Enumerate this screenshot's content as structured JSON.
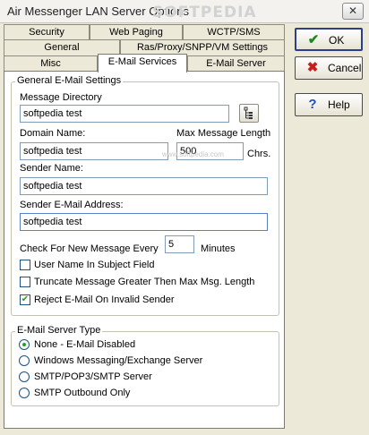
{
  "window": {
    "title": "Air Messenger LAN Server Options",
    "watermark": "SOFTPEDIA",
    "watermark_url": "www.softpedia.com"
  },
  "tabs": {
    "row1": [
      "Security",
      "Web Paging",
      "WCTP/SMS"
    ],
    "row2": [
      "General",
      "Ras/Proxy/SNPP/VM Settings"
    ],
    "row3": [
      "Misc",
      "E-Mail Services",
      "E-Mail Server"
    ]
  },
  "general": {
    "group_label": "General E-Mail Settings",
    "message_directory": {
      "label": "Message Directory",
      "value": "softpedia test"
    },
    "domain_name": {
      "label": "Domain Name:",
      "value": "softpedia test"
    },
    "max_length": {
      "label": "Max Message Length",
      "value": "500",
      "unit": "Chrs."
    },
    "sender_name": {
      "label": "Sender Name:",
      "value": "softpedia test"
    },
    "sender_email": {
      "label": "Sender E-Mail Address:",
      "value": "softpedia test"
    },
    "check_every": {
      "label": "Check For New Message Every",
      "value": "5",
      "unit": "Minutes"
    },
    "options": [
      {
        "label": "User Name In Subject Field",
        "checked": false
      },
      {
        "label": "Truncate Message Greater Then Max Msg. Length",
        "checked": false
      },
      {
        "label": "Reject E-Mail On Invalid Sender",
        "checked": true
      }
    ]
  },
  "server_type": {
    "group_label": "E-Mail Server Type",
    "options": [
      {
        "label": "None - E-Mail Disabled",
        "selected": true
      },
      {
        "label": "Windows Messaging/Exchange Server",
        "selected": false
      },
      {
        "label": "SMTP/POP3/SMTP Server",
        "selected": false
      },
      {
        "label": "SMTP Outbound Only",
        "selected": false
      }
    ]
  },
  "buttons": {
    "ok": {
      "label": "OK",
      "icon": "checkmark-icon",
      "color": "#1d8a1d"
    },
    "cancel": {
      "label": "Cancel",
      "icon": "x-icon",
      "color": "#c81e1e"
    },
    "help": {
      "label": "Help",
      "icon": "question-icon",
      "color": "#2050b8"
    }
  }
}
